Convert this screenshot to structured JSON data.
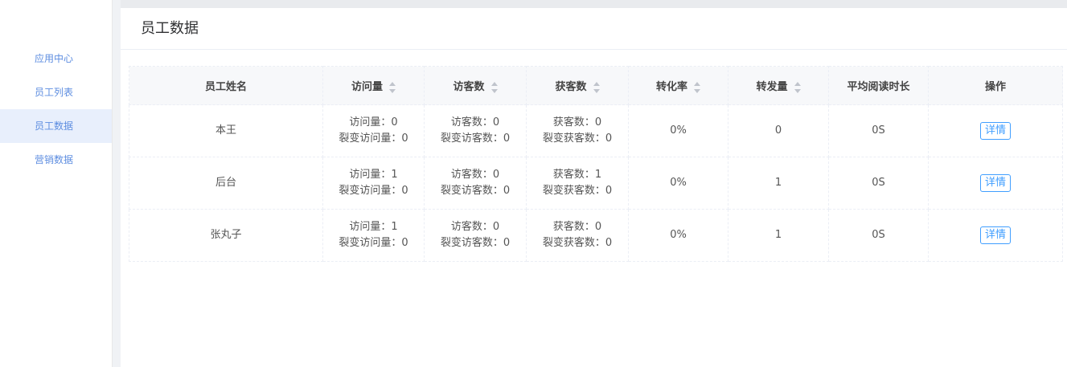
{
  "sidebar": {
    "items": [
      {
        "label": "应用中心"
      },
      {
        "label": "员工列表"
      },
      {
        "label": "员工数据"
      },
      {
        "label": "营销数据"
      }
    ]
  },
  "page": {
    "title": "员工数据"
  },
  "table": {
    "headers": [
      "员工姓名",
      "访问量",
      "访客数",
      "获客数",
      "转化率",
      "转发量",
      "平均阅读时长",
      "操作"
    ],
    "rows": [
      {
        "name": "本王",
        "visits": "访问量：0",
        "fission_visits": "裂变访问量：0",
        "visitors": "访客数：0",
        "fission_visitors": "裂变访客数：0",
        "acquired": "获客数：0",
        "fission_acquired": "裂变获客数：0",
        "conversion": "0%",
        "shares": "0",
        "avg_read": "0S",
        "action": "详情"
      },
      {
        "name": "后台",
        "visits": "访问量：1",
        "fission_visits": "裂变访问量：0",
        "visitors": "访客数：0",
        "fission_visitors": "裂变访客数：0",
        "acquired": "获客数：1",
        "fission_acquired": "裂变获客数：0",
        "conversion": "0%",
        "shares": "1",
        "avg_read": "0S",
        "action": "详情"
      },
      {
        "name": "张丸子",
        "visits": "访问量：1",
        "fission_visits": "裂变访问量：0",
        "visitors": "访客数：0",
        "fission_visitors": "裂变访客数：0",
        "acquired": "获客数：0",
        "fission_acquired": "裂变获客数：0",
        "conversion": "0%",
        "shares": "1",
        "avg_read": "0S",
        "action": "详情"
      }
    ]
  }
}
